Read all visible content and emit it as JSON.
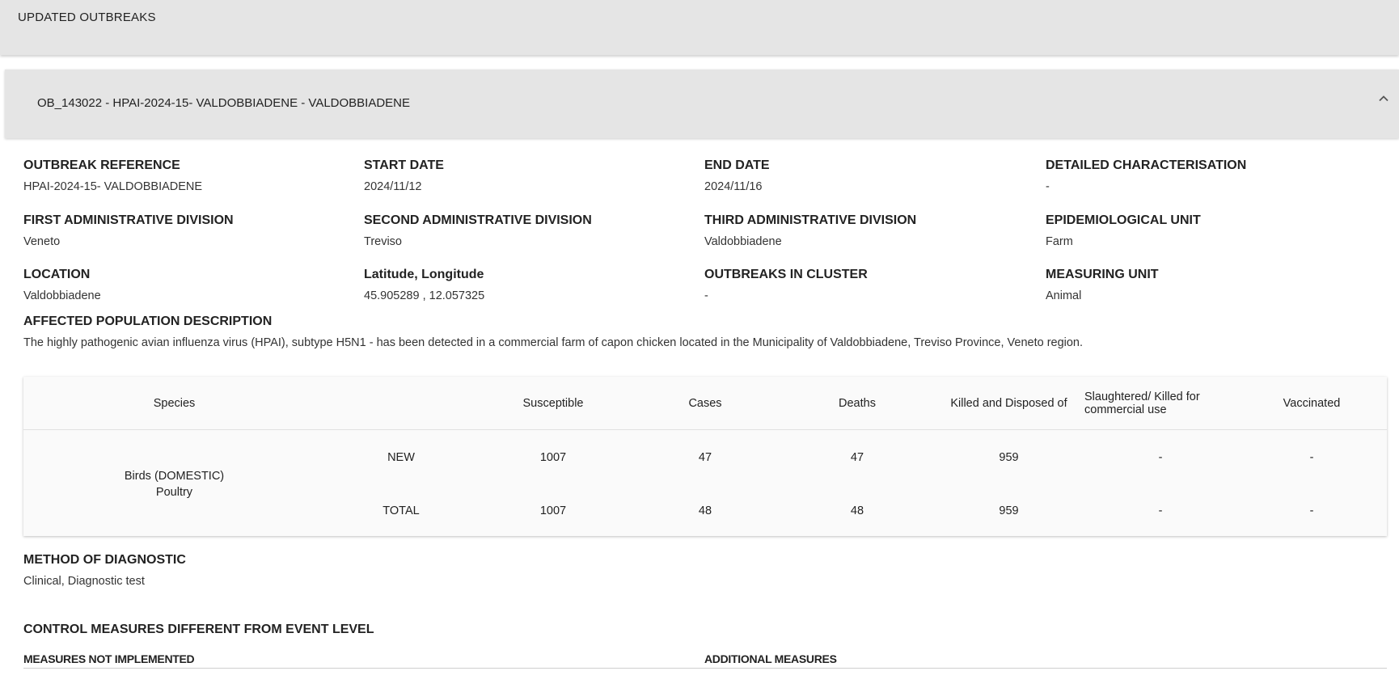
{
  "header": {
    "title": "UPDATED OUTBREAKS"
  },
  "outbreak": {
    "title": "OB_143022 - HPAI-2024-15- VALDOBBIADENE - VALDOBBIADENE",
    "fields": {
      "outbreak_reference": {
        "label": "OUTBREAK REFERENCE",
        "value": "HPAI-2024-15- VALDOBBIADENE"
      },
      "start_date": {
        "label": "START DATE",
        "value": "2024/11/12"
      },
      "end_date": {
        "label": "END DATE",
        "value": "2024/11/16"
      },
      "detailed_characterisation": {
        "label": "DETAILED CHARACTERISATION",
        "value": "-"
      },
      "first_admin": {
        "label": "FIRST ADMINISTRATIVE DIVISION",
        "value": "Veneto"
      },
      "second_admin": {
        "label": "SECOND ADMINISTRATIVE DIVISION",
        "value": "Treviso"
      },
      "third_admin": {
        "label": "THIRD ADMINISTRATIVE DIVISION",
        "value": "Valdobbiadene"
      },
      "epi_unit": {
        "label": "EPIDEMIOLOGICAL UNIT",
        "value": "Farm"
      },
      "location": {
        "label": "LOCATION",
        "value": "Valdobbiadene"
      },
      "lat_long": {
        "label": "Latitude, Longitude",
        "value": "45.905289 , 12.057325"
      },
      "outbreaks_in_cluster": {
        "label": "OUTBREAKS IN CLUSTER",
        "value": "-"
      },
      "measuring_unit": {
        "label": "MEASURING UNIT",
        "value": "Animal"
      }
    },
    "affected_population": {
      "label": "AFFECTED POPULATION DESCRIPTION",
      "value": "The highly pathogenic avian influenza virus (HPAI), subtype H5N1 - has been detected in a commercial farm of capon chicken located in the Municipality of Valdobbiadene, Treviso Province, Veneto region."
    },
    "table": {
      "headers": [
        "Species",
        "",
        "Susceptible",
        "Cases",
        "Deaths",
        "Killed and Disposed of",
        "Slaughtered/ Killed for commercial use",
        "Vaccinated"
      ],
      "species": {
        "line1": "Birds (DOMESTIC)",
        "line2": "Poultry"
      },
      "rows": [
        {
          "type": "NEW",
          "susceptible": "1007",
          "cases": "47",
          "deaths": "47",
          "killed": "959",
          "slaughtered": "-",
          "vaccinated": "-"
        },
        {
          "type": "TOTAL",
          "susceptible": "1007",
          "cases": "48",
          "deaths": "48",
          "killed": "959",
          "slaughtered": "-",
          "vaccinated": "-"
        }
      ]
    },
    "method": {
      "label": "METHOD OF DIAGNOSTIC",
      "value": "Clinical, Diagnostic test"
    },
    "control": {
      "title": "CONTROL MEASURES DIFFERENT FROM EVENT LEVEL",
      "not_implemented": "MEASURES NOT IMPLEMENTED",
      "additional": "ADDITIONAL MEASURES"
    }
  }
}
